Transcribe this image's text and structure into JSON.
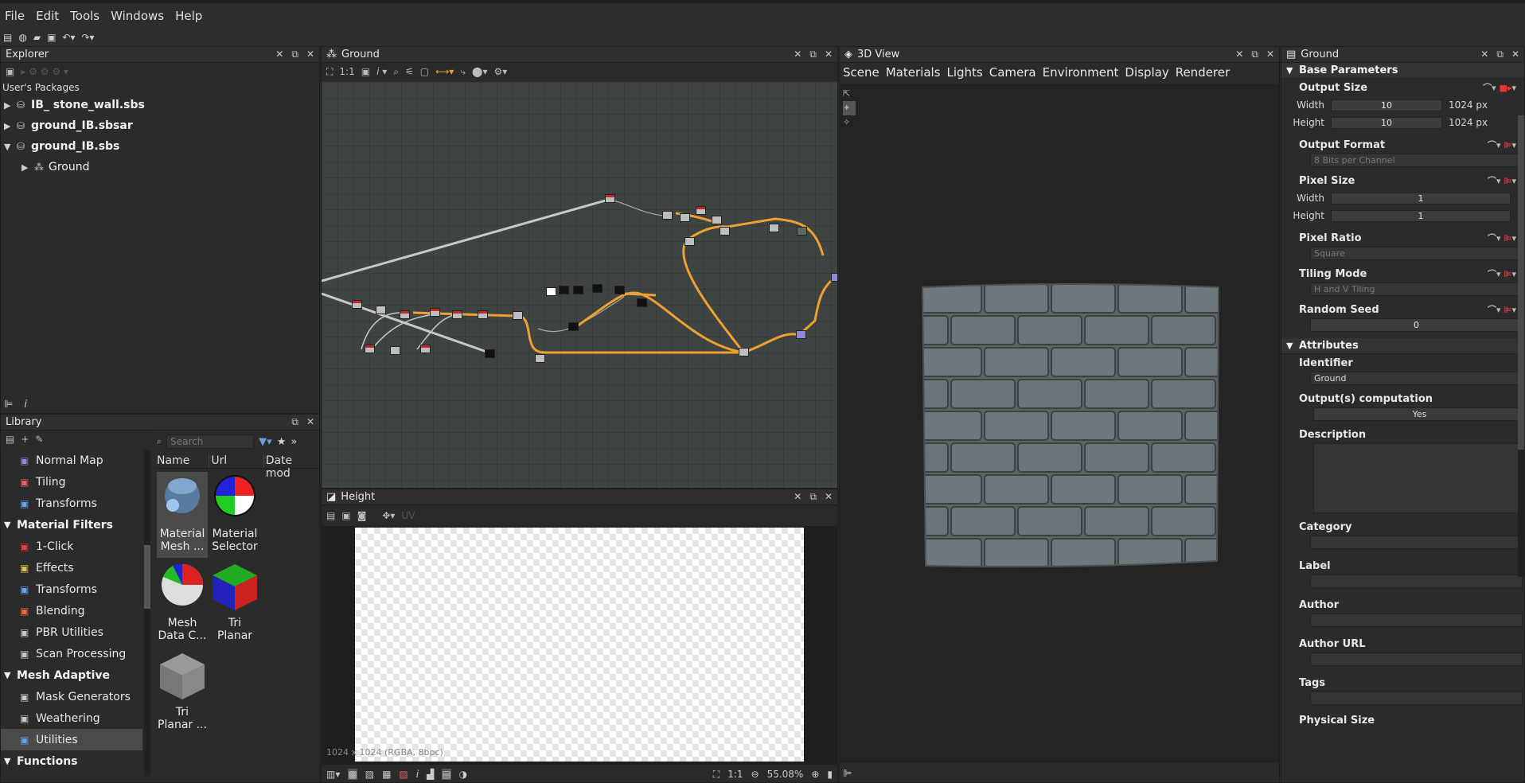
{
  "menu": [
    "File",
    "Edit",
    "Tools",
    "Windows",
    "Help"
  ],
  "explorer": {
    "title": "Explorer",
    "section": "User's Packages",
    "items": [
      {
        "label": "IB_ stone_wall.sbs",
        "expanded": false,
        "level": 0
      },
      {
        "label": "ground_IB.sbsar",
        "expanded": false,
        "level": 0
      },
      {
        "label": "ground_IB.sbs",
        "expanded": true,
        "level": 0
      },
      {
        "label": "Ground",
        "expanded": false,
        "level": 1
      }
    ]
  },
  "graph": {
    "title": "Ground",
    "zoom_label": "1:1"
  },
  "view3d": {
    "title": "3D View",
    "menu": [
      "Scene",
      "Materials",
      "Lights",
      "Camera",
      "Environment",
      "Display",
      "Renderer"
    ]
  },
  "library": {
    "title": "Library",
    "search_placeholder": "Search",
    "columns": [
      "Name",
      "Url",
      "Date mod"
    ],
    "rows": [
      {
        "type": "item",
        "label": "Normal Map",
        "color": "#8a8ad8"
      },
      {
        "type": "item",
        "label": "Tiling",
        "color": "#d66"
      },
      {
        "type": "item",
        "label": "Transforms",
        "color": "#6aa0e0"
      },
      {
        "type": "category",
        "label": "Material Filters"
      },
      {
        "type": "item",
        "label": "1-Click",
        "color": "#d44"
      },
      {
        "type": "item",
        "label": "Effects",
        "color": "#e0c060"
      },
      {
        "type": "item",
        "label": "Transforms",
        "color": "#6aa0e0"
      },
      {
        "type": "item",
        "label": "Blending",
        "color": "#e07040"
      },
      {
        "type": "item",
        "label": "PBR Utilities",
        "color": "#c8c8c8"
      },
      {
        "type": "item",
        "label": "Scan Processing",
        "color": "#c8c8c8"
      },
      {
        "type": "category",
        "label": "Mesh Adaptive"
      },
      {
        "type": "item",
        "label": "Mask Generators",
        "color": "#c8c8c8"
      },
      {
        "type": "item",
        "label": "Weathering",
        "color": "#c8c8c8"
      },
      {
        "type": "item",
        "label": "Utilities",
        "color": "#6aa0e0",
        "selected": true
      },
      {
        "type": "category",
        "label": "Functions"
      }
    ],
    "thumbnails": [
      {
        "label1": "Material",
        "label2": "Mesh ..."
      },
      {
        "label1": "Material",
        "label2": "Selector"
      },
      {
        "label1": "Mesh",
        "label2": "Data C..."
      },
      {
        "label1": "Tri",
        "label2": "Planar"
      },
      {
        "label1": "Tri",
        "label2": "Planar ..."
      }
    ]
  },
  "height_view": {
    "title": "Height",
    "uv_label": "UV",
    "info": "1024 x 1024 (RGBA, 8bpc)",
    "zoom_ratio": "1:1",
    "zoom_percent": "55.08%"
  },
  "properties": {
    "title": "Ground",
    "base_section": "Base Parameters",
    "output_size": {
      "label": "Output Size",
      "width_label": "Width",
      "width_value": "10",
      "width_px": "1024 px",
      "height_label": "Height",
      "height_value": "10",
      "height_px": "1024 px"
    },
    "output_format": {
      "label": "Output Format",
      "value": "8 Bits per Channel"
    },
    "pixel_size": {
      "label": "Pixel Size",
      "width_label": "Width",
      "width_value": "1",
      "height_label": "Height",
      "height_value": "1"
    },
    "pixel_ratio": {
      "label": "Pixel Ratio",
      "value": "Square"
    },
    "tiling_mode": {
      "label": "Tiling Mode",
      "value": "H and V Tiling"
    },
    "random_seed": {
      "label": "Random Seed",
      "value": "0"
    },
    "attributes_section": "Attributes",
    "identifier": {
      "label": "Identifier",
      "value": "Ground"
    },
    "output_computation": {
      "label": "Output(s) computation",
      "value": "Yes"
    },
    "description_label": "Description",
    "category_label": "Category",
    "label_label": "Label",
    "author_label": "Author",
    "author_url_label": "Author URL",
    "tags_label": "Tags",
    "physical_size_label": "Physical Size"
  }
}
